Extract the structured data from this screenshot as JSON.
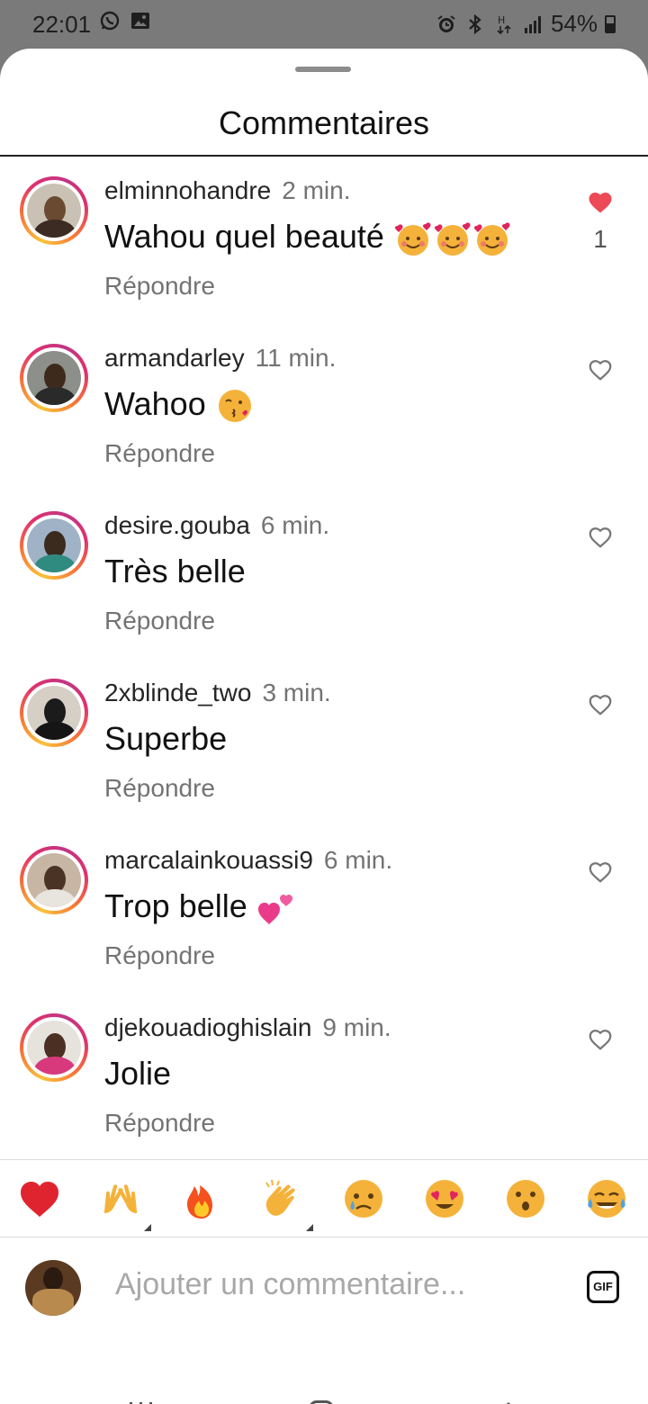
{
  "status_bar": {
    "time": "22:01",
    "left_icons": [
      "whatsapp-icon",
      "gallery-icon"
    ],
    "right_icons": [
      "alarm-icon",
      "bluetooth-icon",
      "h-data-icon",
      "signal-icon"
    ],
    "battery": "54%"
  },
  "sheet": {
    "title": "Commentaires"
  },
  "comments": [
    {
      "username": "elminnohandre",
      "time": "2 min.",
      "text": "Wahou quel beauté",
      "emoji": [
        "smiling-face-hearts-emoji",
        "smiling-face-hearts-emoji",
        "smiling-face-hearts-emoji"
      ],
      "reply": "Répondre",
      "liked": true,
      "like_count": "1"
    },
    {
      "username": "armandarley",
      "time": "11 min.",
      "text": "Wahoo",
      "emoji": [
        "kissing-face-emoji"
      ],
      "reply": "Répondre",
      "liked": false
    },
    {
      "username": "desire.gouba",
      "time": "6 min.",
      "text": "Très belle",
      "emoji": [],
      "reply": "Répondre",
      "liked": false
    },
    {
      "username": "2xblinde_two",
      "time": "3 min.",
      "text": "Superbe",
      "emoji": [],
      "reply": "Répondre",
      "liked": false
    },
    {
      "username": "marcalainkouassi9",
      "time": "6 min.",
      "text": "Trop belle",
      "emoji": [
        "two-hearts-emoji"
      ],
      "reply": "Répondre",
      "liked": false
    },
    {
      "username": "djekouadioghislain",
      "time": "9 min.",
      "text": "Jolie",
      "emoji": [],
      "reply": "Répondre",
      "liked": false
    }
  ],
  "reactions": [
    "red-heart-emoji",
    "raising-hands-emoji",
    "fire-emoji",
    "clapping-hands-emoji",
    "crying-face-emoji",
    "heart-eyes-emoji",
    "surprised-face-emoji",
    "tears-of-joy-emoji"
  ],
  "input": {
    "placeholder": "Ajouter un commentaire...",
    "gif_label": "GIF"
  },
  "colors": {
    "like_red": "#ed4956",
    "muted_text": "#737373",
    "placeholder": "#a8a8a8"
  }
}
